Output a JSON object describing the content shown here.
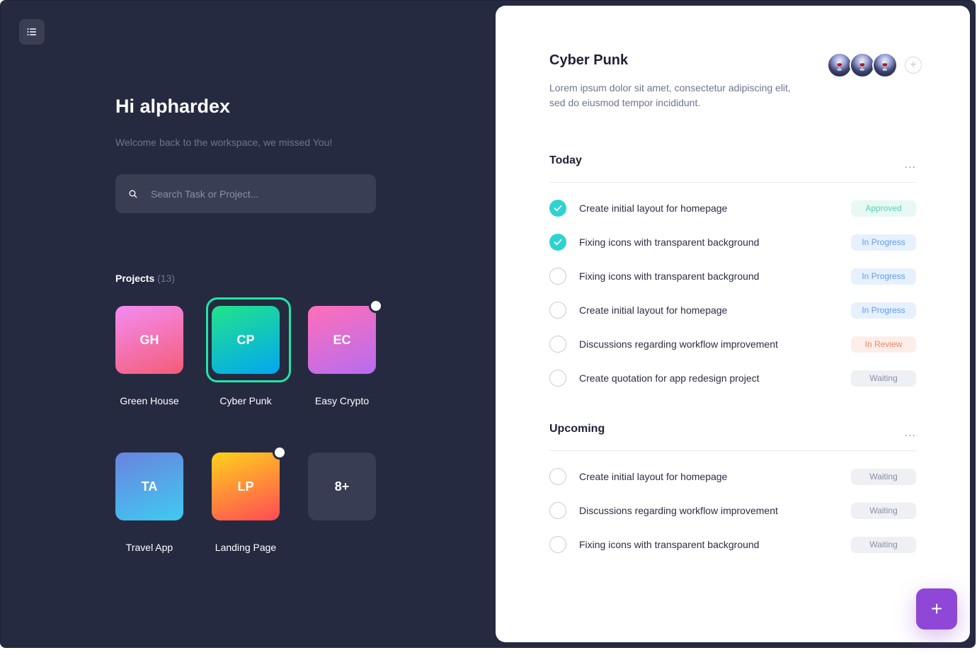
{
  "sidebar": {
    "menu_icon": "list-icon"
  },
  "greeting": "Hi alphardex",
  "subtitle": "Welcome back to the workspace, we missed You!",
  "search": {
    "placeholder": "Search Task or Project...",
    "icon": "search-icon"
  },
  "projects": {
    "label": "Projects",
    "count": "(13)",
    "items": [
      {
        "initials": "GH",
        "name": "Green House",
        "gradient": [
          "#f38cf3",
          "#f55c77"
        ],
        "notification": false,
        "selected": false
      },
      {
        "initials": "CP",
        "name": "Cyber Punk",
        "gradient": [
          "#22e38a",
          "#02a7f0"
        ],
        "notification": false,
        "selected": true
      },
      {
        "initials": "EC",
        "name": "Easy Crypto",
        "gradient": [
          "#ff6fb8",
          "#b76cf0"
        ],
        "notification": true,
        "selected": false
      },
      {
        "initials": "TA",
        "name": "Travel App",
        "gradient": [
          "#6b82e0",
          "#3ecbf0"
        ],
        "notification": false,
        "selected": false
      },
      {
        "initials": "LP",
        "name": "Landing Page",
        "gradient": [
          "#ffd21a",
          "#ff4a55"
        ],
        "notification": true,
        "selected": false
      },
      {
        "initials": "8+",
        "name": "",
        "gradient": [
          "#393d53",
          "#393d53"
        ],
        "notification": false,
        "selected": false
      }
    ]
  },
  "panel": {
    "title": "Cyber Punk",
    "description": "Lorem ipsum dolor sit amet, consectetur adipiscing elit, sed do eiusmod tempor incididunt.",
    "members": [
      "avatar-1",
      "avatar-2",
      "avatar-3"
    ],
    "add_member_icon": "plus-circle-icon",
    "today": {
      "title": "Today",
      "more": "...",
      "tasks": [
        {
          "label": "Create initial layout for homepage",
          "done": true,
          "status": "Approved",
          "kind": "approved"
        },
        {
          "label": "Fixing icons with transparent background",
          "done": true,
          "status": "In Progress",
          "kind": "progress"
        },
        {
          "label": "Fixing icons with transparent background",
          "done": false,
          "status": "In Progress",
          "kind": "progress"
        },
        {
          "label": "Create initial layout for homepage",
          "done": false,
          "status": "In Progress",
          "kind": "progress"
        },
        {
          "label": "Discussions regarding workflow improvement",
          "done": false,
          "status": "In Review",
          "kind": "review"
        },
        {
          "label": "Create quotation for app redesign project",
          "done": false,
          "status": "Waiting",
          "kind": "waiting"
        }
      ]
    },
    "upcoming": {
      "title": "Upcoming",
      "more": "...",
      "tasks": [
        {
          "label": "Create initial layout for homepage",
          "done": false,
          "status": "Waiting",
          "kind": "waiting"
        },
        {
          "label": "Discussions regarding workflow improvement",
          "done": false,
          "status": "Waiting",
          "kind": "waiting"
        },
        {
          "label": "Fixing icons with transparent background",
          "done": false,
          "status": "Waiting",
          "kind": "waiting"
        }
      ]
    }
  },
  "fab": {
    "label": "+",
    "icon": "plus-icon",
    "color": "#8e47d6"
  }
}
